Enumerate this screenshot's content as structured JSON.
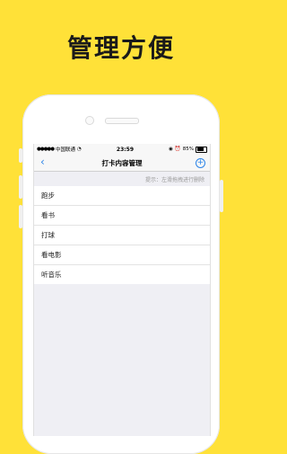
{
  "headline": "管理方便",
  "status_bar": {
    "carrier": "中国联通",
    "time": "23:59",
    "battery": "85%",
    "battery_level": 0.85
  },
  "nav": {
    "title": "打卡内容管理",
    "back_icon": "chevron-left-icon",
    "add_icon": "plus-circle-icon",
    "accent_color": "#2b84e8"
  },
  "hint": "提示：左滑拖拽进行删除",
  "items": [
    {
      "label": "跑步"
    },
    {
      "label": "看书"
    },
    {
      "label": "打球"
    },
    {
      "label": "看电影"
    },
    {
      "label": "听音乐"
    }
  ],
  "colors": {
    "background": "#FFE138"
  }
}
